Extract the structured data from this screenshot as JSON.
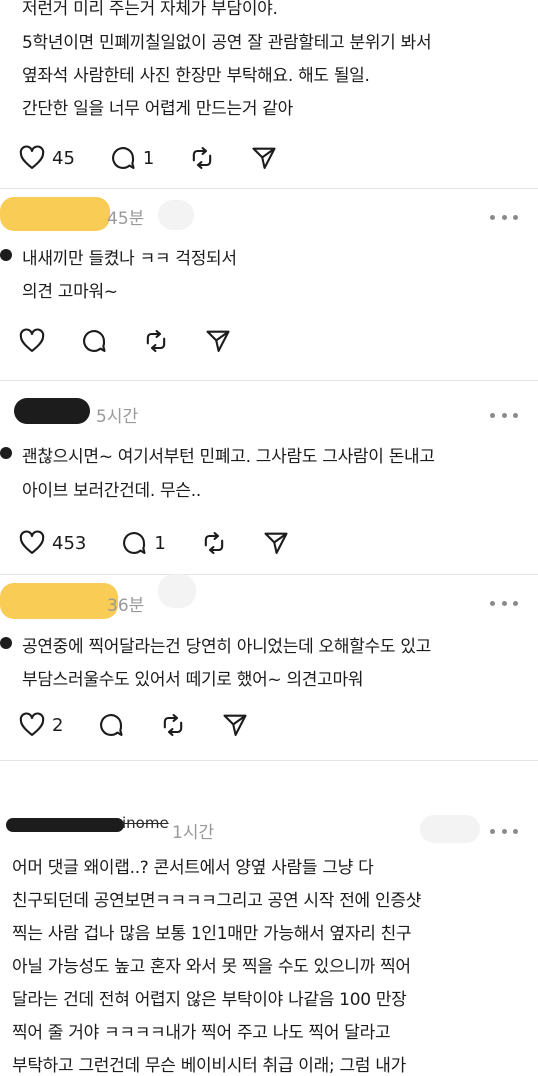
{
  "post0": {
    "lines": [
      "저런거 미리 주는거 자체가 부담이야.",
      "5학년이면 민폐끼칠일없이 공연 잘 관람할테고 분위기 봐서",
      "옆좌석 사람한테 사진 한장만 부탁해요. 해도 될일.",
      "간단한 일을 너무 어렵게 만드는거 같아"
    ],
    "likes": "45",
    "replies": "1"
  },
  "reply1": {
    "time": "45분",
    "lines": [
      "내새끼만 들켰나 ㅋㅋ 걱정되서",
      "의견 고마워~"
    ]
  },
  "comment2": {
    "time": "5시간",
    "lines": [
      "괜찮으시면~ 여기서부턴 민폐고. 그사람도 그사람이 돈내고",
      "아이브 보러간건데. 무슨.."
    ],
    "likes": "453",
    "replies": "1"
  },
  "reply3": {
    "time": "36분",
    "lines": [
      "공연중에 찍어달라는건 당연히 아니었는데 오해할수도 있고",
      "부담스러울수도 있어서 떼기로 했어~ 의견고마워"
    ],
    "likes": "2"
  },
  "comment4": {
    "username_partial": "inome",
    "time": "1시간",
    "lines": [
      "어머 댓글 왜이랩..? 콘서트에서 양옆 사람들 그냥 다",
      "친구되던데 공연보면ㅋㅋㅋㅋ그리고 공연 시작 전에 인증샷",
      "찍는 사람 겁나 많음 보통 1인1￼매만 가능해서 옆자리 친구",
      "아닐 가능성도 높고 혼자 와서 못 찍을 수도 있으니까 찍어",
      "달라는 건데 전혀 어렵지 않은 부탁이야 나같음 100 만장",
      "찍어 줄 거야 ㅋㅋㅋㅋ내가 찍어 주고 나도 찍어 달라고",
      "부탁하고 그런건데 무슨 베이비시터 취급 이래; 그럼 내가"
    ]
  },
  "icons": [
    "heart-icon",
    "comment-icon",
    "repost-icon",
    "share-icon",
    "more-icon"
  ],
  "colors": {
    "redaction_yellow": "#f9cc56",
    "meta_gray": "#9a9a9a"
  }
}
